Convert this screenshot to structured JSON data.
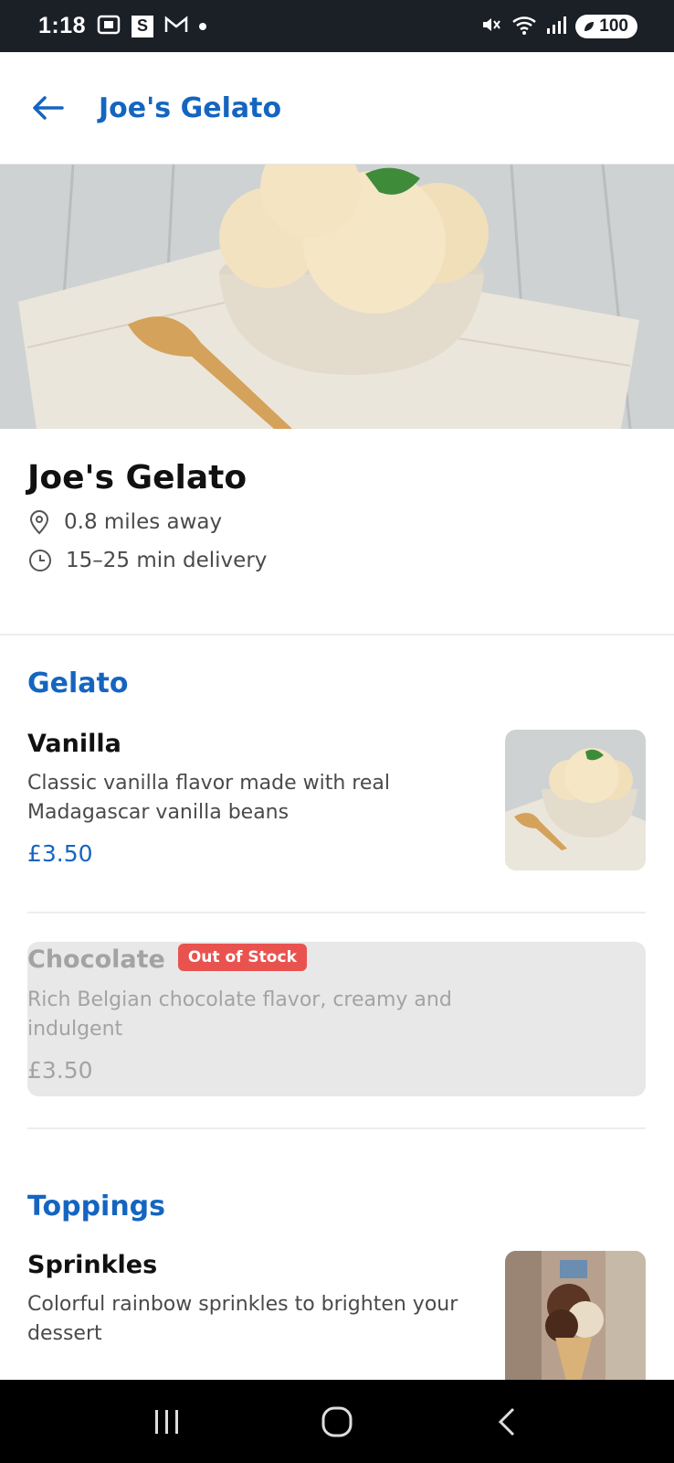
{
  "status_bar": {
    "time": "1:18",
    "battery": "100"
  },
  "app_bar": {
    "title": "Joe's Gelato"
  },
  "restaurant": {
    "name": "Joe's Gelato",
    "distance": "0.8 miles away",
    "delivery": "15–25 min delivery"
  },
  "sections": [
    {
      "title": "Gelato",
      "items": [
        {
          "name": "Vanilla",
          "description": "Classic vanilla flavor made with real Madagascar vanilla beans",
          "price": "£3.50"
        },
        {
          "name": "Chocolate",
          "badge": "Out of Stock",
          "description": "Rich Belgian chocolate flavor, creamy and indulgent",
          "price": "£3.50"
        }
      ]
    },
    {
      "title": "Toppings",
      "items": [
        {
          "name": "Sprinkles",
          "description": "Colorful rainbow sprinkles to brighten your dessert"
        }
      ]
    }
  ],
  "colors": {
    "accent": "#1565c0",
    "badge": "#e9534f",
    "disabled_bg": "#e8e8e8",
    "status_bar": "#1b1f26"
  },
  "icons": {
    "back": "arrow-left-icon",
    "location": "map-pin-icon",
    "clock": "clock-icon",
    "nav_recents": "recents-icon",
    "nav_home": "home-icon",
    "nav_back": "chevron-left-icon"
  }
}
